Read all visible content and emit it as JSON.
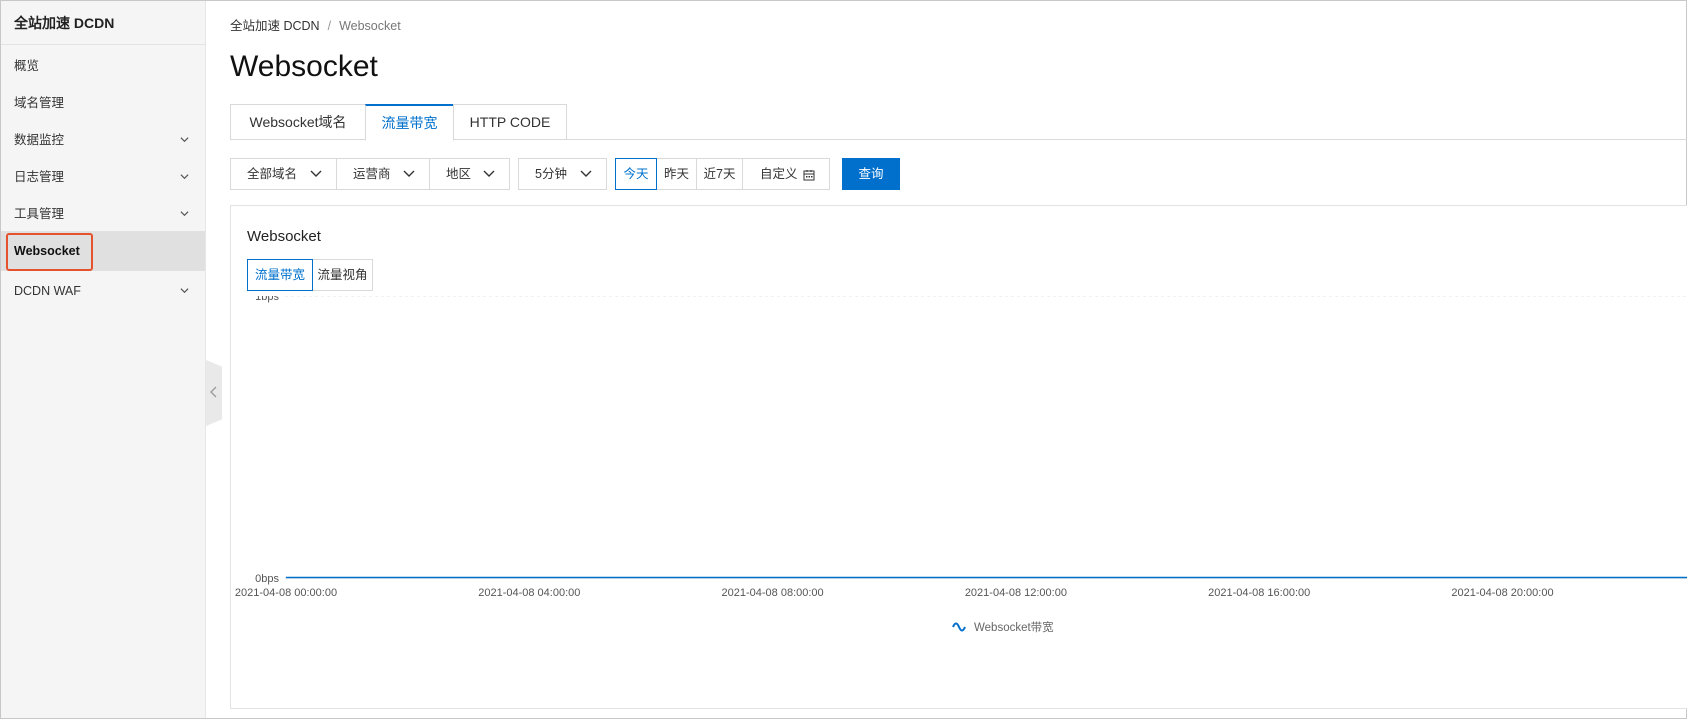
{
  "sidebar": {
    "title": "全站加速 DCDN",
    "items": [
      {
        "label": "概览",
        "has_children": false,
        "active": false
      },
      {
        "label": "域名管理",
        "has_children": false,
        "active": false
      },
      {
        "label": "数据监控",
        "has_children": true,
        "active": false
      },
      {
        "label": "日志管理",
        "has_children": true,
        "active": false
      },
      {
        "label": "工具管理",
        "has_children": true,
        "active": false
      },
      {
        "label": "Websocket",
        "has_children": false,
        "active": true
      },
      {
        "label": "DCDN WAF",
        "has_children": true,
        "active": false
      }
    ]
  },
  "breadcrumb": {
    "root": "全站加速 DCDN",
    "separator": "/",
    "current": "Websocket"
  },
  "page_title": "Websocket",
  "tabs": [
    {
      "label": "Websocket域名",
      "active": false
    },
    {
      "label": "流量带宽",
      "active": true
    },
    {
      "label": "HTTP CODE",
      "active": false
    }
  ],
  "filters": {
    "domain": "全部域名",
    "isp": "运营商",
    "region": "地区",
    "interval": "5分钟",
    "time_today": "今天",
    "time_yesterday": "昨天",
    "time_7days": "近7天",
    "time_custom": "自定义",
    "query_button": "查询"
  },
  "card": {
    "title": "Websocket",
    "sub_tabs": [
      {
        "label": "流量带宽",
        "active": true
      },
      {
        "label": "流量视角",
        "active": false
      }
    ]
  },
  "colors": {
    "accent": "#0070cc",
    "highlight_box": "#e4532d"
  },
  "chart_data": {
    "type": "line",
    "title": "",
    "xlabel": "",
    "ylabel": "",
    "y_ticks": [
      "1bps",
      "0bps"
    ],
    "ylim": [
      0,
      1
    ],
    "x_ticks": [
      "2021-04-08 00:00:00",
      "2021-04-08 04:00:00",
      "2021-04-08 08:00:00",
      "2021-04-08 12:00:00",
      "2021-04-08 16:00:00",
      "2021-04-08 20:00:00"
    ],
    "x": [
      "2021-04-08 00:00:00",
      "2021-04-08 04:00:00",
      "2021-04-08 08:00:00",
      "2021-04-08 12:00:00",
      "2021-04-08 16:00:00",
      "2021-04-08 20:00:00",
      "2021-04-08 21:00:00"
    ],
    "series": [
      {
        "name": "Websocket带宽",
        "values": [
          0,
          0,
          0,
          0,
          0,
          0,
          0
        ],
        "color": "#0070cc"
      }
    ],
    "grid": true,
    "legend_position": "bottom-center"
  }
}
